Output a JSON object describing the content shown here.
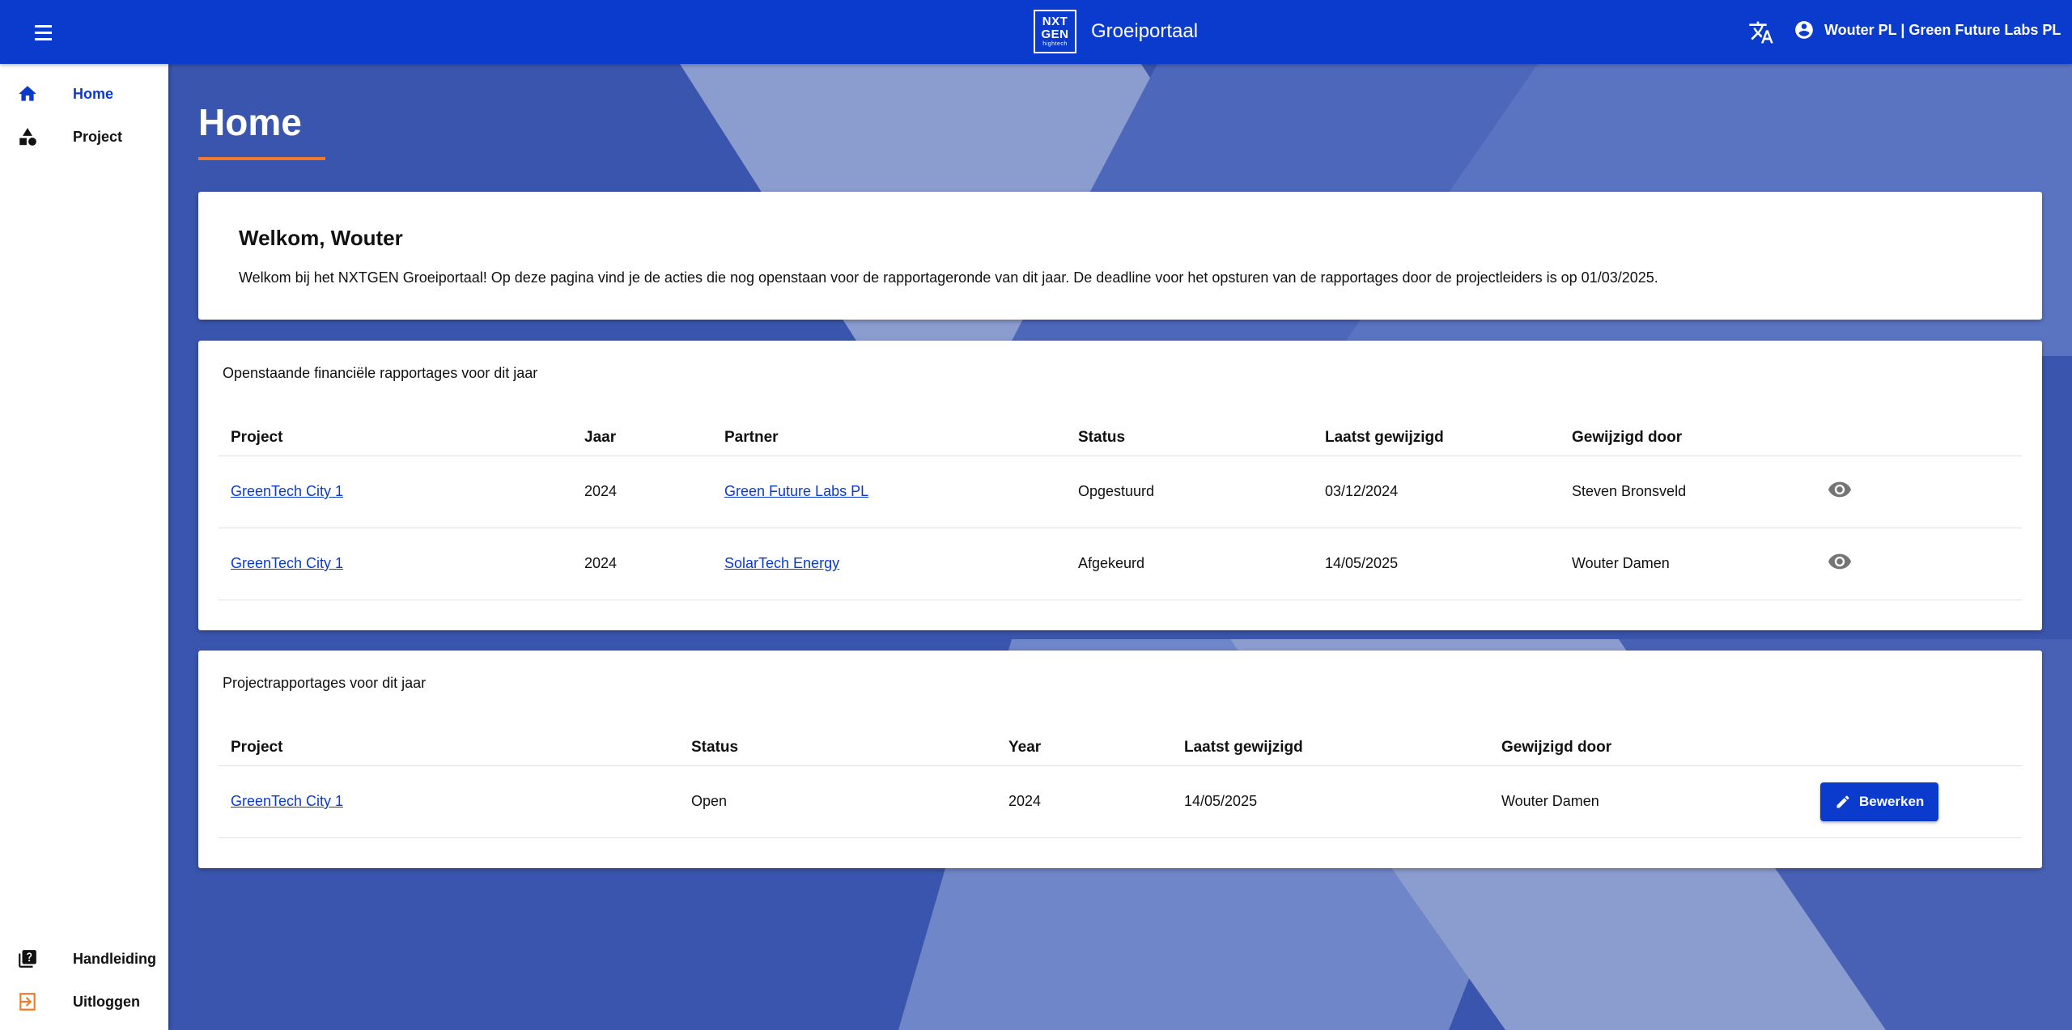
{
  "topbar": {
    "brand_title": "Groeiportaal",
    "logo_line1": "NXT",
    "logo_line2": "GEN",
    "logo_line3": "hightech",
    "user_name": "Wouter PL | Green Future Labs PL"
  },
  "sidebar": {
    "items": [
      {
        "label": "Home",
        "icon": "home-icon"
      },
      {
        "label": "Project",
        "icon": "shapes-icon"
      }
    ],
    "bottom_items": [
      {
        "label": "Handleiding",
        "icon": "help-book-icon"
      },
      {
        "label": "Uitloggen",
        "icon": "logout-icon"
      }
    ]
  },
  "page": {
    "title": "Home"
  },
  "welcome": {
    "heading": "Welkom, Wouter",
    "text": "Welkom bij het NXTGEN Groeiportaal! Op deze pagina vind je de acties die nog openstaan voor de rapportageronde van dit jaar. De deadline voor het opsturen van de rapportages door de projectleiders is op 01/03/2025."
  },
  "financial": {
    "title": "Openstaande financiële rapportages voor dit jaar",
    "columns": [
      "Project",
      "Jaar",
      "Partner",
      "Status",
      "Laatst gewijzigd",
      "Gewijzigd door"
    ],
    "rows": [
      {
        "project": "GreenTech City 1",
        "year": "2024",
        "partner": "Green Future Labs PL",
        "status": "Opgestuurd",
        "modified": "03/12/2024",
        "modified_by": "Steven Bronsveld"
      },
      {
        "project": "GreenTech City 1",
        "year": "2024",
        "partner": "SolarTech Energy",
        "status": "Afgekeurd",
        "modified": "14/05/2025",
        "modified_by": "Wouter Damen"
      }
    ]
  },
  "project_reports": {
    "title": "Projectrapportages voor dit jaar",
    "columns": [
      "Project",
      "Status",
      "Year",
      "Laatst gewijzigd",
      "Gewijzigd door"
    ],
    "rows": [
      {
        "project": "GreenTech City 1",
        "status": "Open",
        "year": "2024",
        "modified": "14/05/2025",
        "modified_by": "Wouter Damen",
        "action_label": "Bewerken"
      }
    ]
  },
  "colors": {
    "primary": "#0a3bcc",
    "accent": "#f07a28",
    "background": "#3a56b0"
  }
}
